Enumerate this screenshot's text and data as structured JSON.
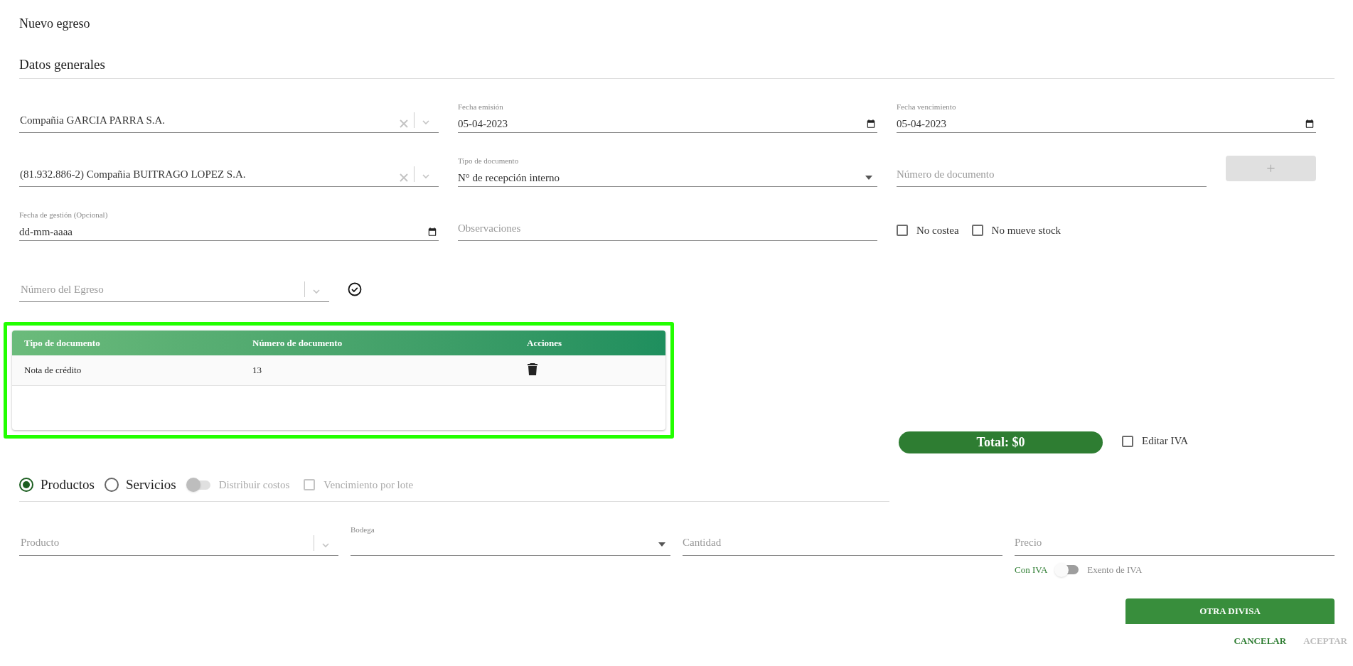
{
  "title": "Nuevo egreso",
  "section": "Datos generales",
  "empresa": {
    "value": "Compañia GARCIA PARRA S.A."
  },
  "fecha_emision": {
    "label": "Fecha emisión",
    "value": "05-04-2023"
  },
  "fecha_vencimiento": {
    "label": "Fecha vencimiento",
    "value": "05-04-2023"
  },
  "proveedor": {
    "value": "(81.932.886-2) Compañia BUITRAGO LOPEZ S.A."
  },
  "tipo_documento": {
    "label": "Tipo de documento",
    "value": "N° de recepción interno"
  },
  "numero_documento": {
    "placeholder": "Número de documento"
  },
  "add_button": {
    "label": "+",
    "disabled": true
  },
  "fecha_gestion": {
    "label": "Fecha de gestión (Opcional)",
    "placeholder": "dd-mm-aaaa"
  },
  "observaciones": {
    "placeholder": "Observaciones"
  },
  "checkboxes": [
    {
      "label": "No costea",
      "checked": false
    },
    {
      "label": "No mueve stock",
      "checked": false
    }
  ],
  "numero_egreso": {
    "placeholder": "Número del Egreso"
  },
  "table": {
    "columns": [
      "Tipo de documento",
      "Número de documento",
      "Acciones"
    ],
    "rows": [
      {
        "cells": [
          "Nota de crédito",
          "13"
        ]
      }
    ]
  },
  "total": "Total: $0",
  "editar_iva": {
    "label": "Editar IVA",
    "checked": false
  },
  "item_types": [
    {
      "label": "Productos",
      "selected": true
    },
    {
      "label": "Servicios",
      "selected": false
    }
  ],
  "distribuir_costos": {
    "label": "Distribuir costos",
    "on": false,
    "disabled": true
  },
  "vencimiento_lote": {
    "label": "Vencimiento por lote",
    "checked": false,
    "disabled": true
  },
  "producto": {
    "placeholder": "Producto"
  },
  "bodega": {
    "label": "Bodega"
  },
  "cantidad": {
    "placeholder": "Cantidad"
  },
  "precio": {
    "placeholder": "Precio"
  },
  "iva_toggle": {
    "off_label": "Con IVA",
    "on_label": "Exento de IVA",
    "on": false
  },
  "otra_divisa": "OTRA DIVISA",
  "actions": [
    {
      "label": "CANCELAR",
      "disabled": false
    },
    {
      "label": "ACEPTAR",
      "disabled": true
    }
  ]
}
